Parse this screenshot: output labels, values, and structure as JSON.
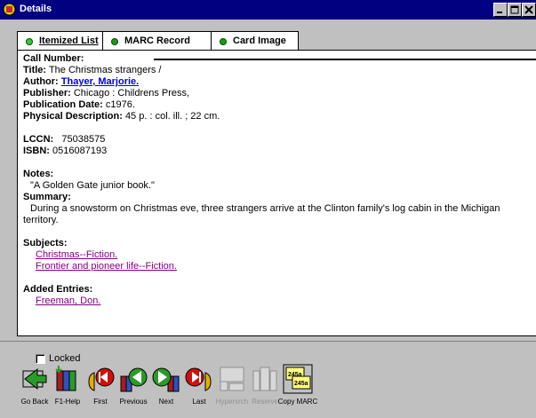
{
  "window": {
    "title": "Details"
  },
  "tabs": [
    {
      "label": "Itemized List",
      "active": true
    },
    {
      "label": "MARC Record",
      "active": false
    },
    {
      "label": "Card Image",
      "active": false
    }
  ],
  "record": {
    "call_number_label": "Call Number:",
    "title_label": "Title:",
    "title": "The Christmas strangers /",
    "author_label": "Author:",
    "author": "Thayer, Marjorie.",
    "publisher_label": "Publisher:",
    "publisher": "Chicago : Childrens Press,",
    "pubdate_label": "Publication Date:",
    "pubdate": "c1976.",
    "physdesc_label": "Physical Description:",
    "physdesc": "45 p. : col. ill. ; 22 cm.",
    "lccn_label": "LCCN:",
    "lccn": "75038575",
    "isbn_label": "ISBN:",
    "isbn": "0516087193",
    "notes_label": "Notes:",
    "notes": "\"A Golden Gate junior book.\"",
    "summary_label": "Summary:",
    "summary_line1": "During a snowstorm on Christmas eve, three strangers arrive at the Clinton family's log cabin in the Michigan",
    "summary_line2": "territory.",
    "subjects_label": "Subjects:",
    "subjects": [
      "Christmas--Fiction.",
      "Frontier and pioneer life--Fiction."
    ],
    "added_label": "Added Entries:",
    "added": [
      "Freeman, Don."
    ]
  },
  "locked": {
    "label": "Locked",
    "checked": false
  },
  "toolbar": [
    {
      "label": "Go Back",
      "icon": "go-back-icon",
      "enabled": true
    },
    {
      "label": "F1-Help",
      "icon": "help-books-icon",
      "enabled": true
    },
    {
      "label": "First",
      "icon": "first-icon",
      "enabled": true
    },
    {
      "label": "Previous",
      "icon": "previous-icon",
      "enabled": true
    },
    {
      "label": "Next",
      "icon": "next-icon",
      "enabled": true
    },
    {
      "label": "Last",
      "icon": "last-icon",
      "enabled": true
    },
    {
      "label": "Hypersrch",
      "icon": "hypersearch-icon",
      "enabled": false
    },
    {
      "label": "Reserve",
      "icon": "reserve-icon",
      "enabled": false
    },
    {
      "label": "Copy MARC",
      "icon": "copy-marc-icon",
      "enabled": true
    }
  ],
  "colors": {
    "titlebar": "#000080",
    "face": "#c0c0c0",
    "link": "#800080",
    "author_link": "#0000ee"
  }
}
